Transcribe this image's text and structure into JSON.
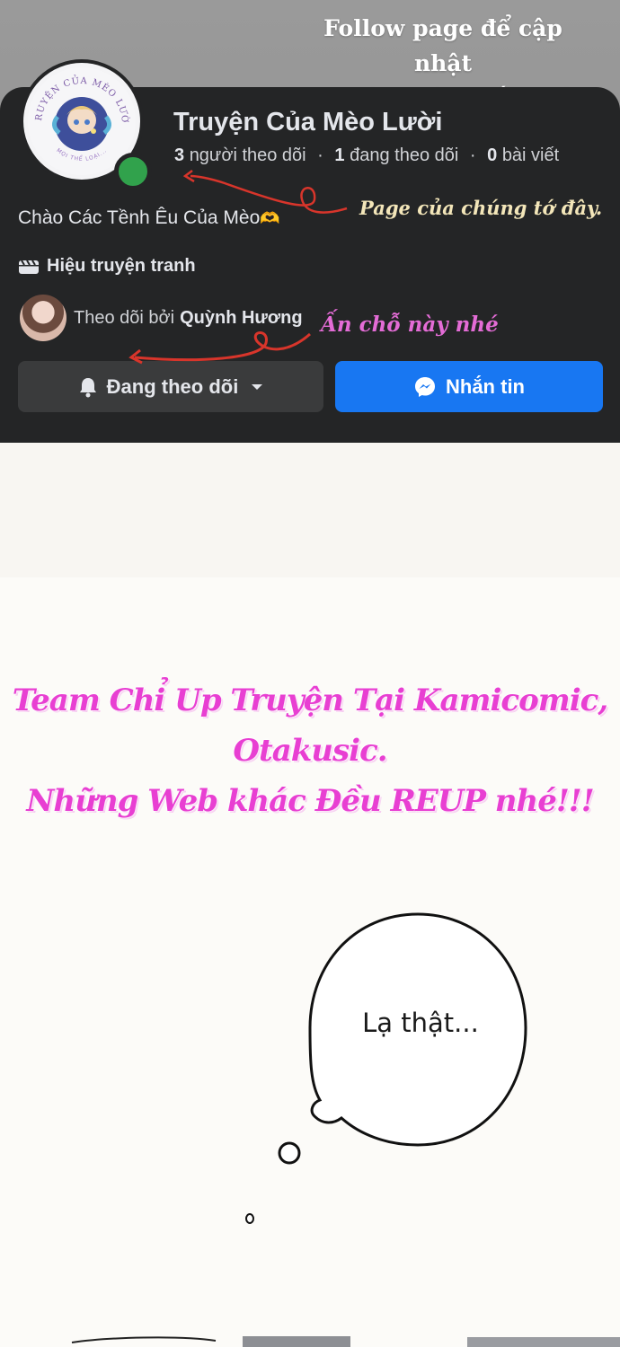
{
  "banner": {
    "line1": "Follow page để cập nhật",
    "line2": "truyện mới nhất nhó"
  },
  "page": {
    "name": "Truyện Của Mèo Lười",
    "avatar_text": "TRUYỆN CỦA MÈO LƯỜI",
    "avatar_subtext": "MỌI THỂ LOẠI...",
    "followers_count": "3",
    "followers_label": "người theo dõi",
    "following_count": "1",
    "following_label": "đang theo dõi",
    "posts_count": "0",
    "posts_label": "bài viết",
    "separator": "·",
    "bio": "Chào Các Tềnh Êu Của Mèo",
    "bio_emoji": "🫶",
    "category": "Hiệu truyện tranh",
    "followed_by_prefix": "Theo dõi bởi",
    "followed_by_name": "Quỳnh Hương"
  },
  "buttons": {
    "follow_label": "Đang theo dõi",
    "message_label": "Nhắn tin"
  },
  "annotations": {
    "page_note": "Page của chúng tớ đây.",
    "click_note": "Ấn chỗ này nhé"
  },
  "comic": {
    "warning_line1": "Team Chỉ Up Truyện Tại Kamicomic, Otakusic.",
    "warning_line2": "Những Web khác Đều REUP nhé!!!",
    "bubble_text": "Lạ thật..."
  },
  "colors": {
    "card_bg": "#242526",
    "message_button": "#1877f2",
    "online_dot": "#31a24c",
    "annotation_pink": "#e46cd6",
    "warning_pink": "#e83fd2"
  }
}
